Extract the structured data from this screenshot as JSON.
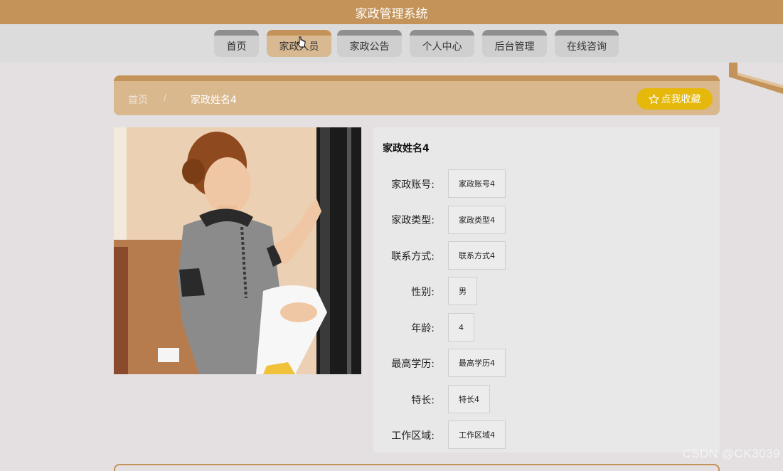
{
  "app": {
    "title": "家政管理系统"
  },
  "nav": {
    "items": [
      {
        "label": "首页"
      },
      {
        "label": "家政人员"
      },
      {
        "label": "家政公告"
      },
      {
        "label": "个人中心"
      },
      {
        "label": "后台管理"
      },
      {
        "label": "在线咨询"
      }
    ],
    "active": "家政人员"
  },
  "breadcrumb": {
    "home": "首页",
    "separator": "/",
    "current": "家政姓名4"
  },
  "favorite_button": {
    "icon": "star-outline-icon",
    "label": "点我收藏"
  },
  "detail": {
    "title": "家政姓名4",
    "fields": [
      {
        "label": "家政账号:",
        "value": "家政账号4"
      },
      {
        "label": "家政类型:",
        "value": "家政类型4"
      },
      {
        "label": "联系方式:",
        "value": "联系方式4"
      },
      {
        "label": "性别:",
        "value": "男"
      },
      {
        "label": "年龄:",
        "value": "4"
      },
      {
        "label": "最高学历:",
        "value": "最高学历4"
      },
      {
        "label": "特长:",
        "value": "特长4"
      },
      {
        "label": "工作区域:",
        "value": "工作区域4"
      }
    ]
  },
  "watermark": "CSDN @CK3039",
  "colors": {
    "brand": "#c49359",
    "nav_bg": "#dcdcdc",
    "favorite": "#e5b80b",
    "page_bg": "#e4e0e2"
  }
}
